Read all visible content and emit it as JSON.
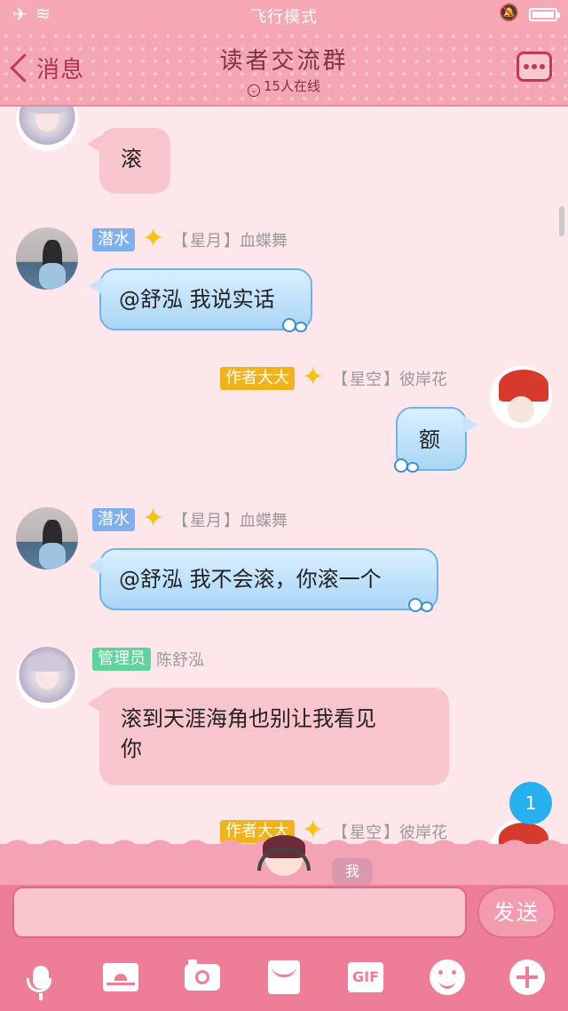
{
  "status_bar": {
    "mode": "飞行模式"
  },
  "header": {
    "back_label": "消息",
    "title": "读者交流群",
    "online": "15人在线"
  },
  "messages": [
    {
      "side": "left",
      "avatar": "girl-silver-icon",
      "text": "滚"
    },
    {
      "side": "left",
      "avatar": "girl-photo-icon",
      "badge": "潜水",
      "title_bracket_l": "【",
      "title": "星月",
      "title_bracket_r": "】",
      "name": "血蝶舞",
      "text": "@舒泓 我说实话"
    },
    {
      "side": "right",
      "avatar": "umbrella-girl-icon",
      "badge": "作者大大",
      "title_bracket_l": "【",
      "title": "星空",
      "title_bracket_r": "】",
      "name": "彼岸花",
      "text": "额"
    },
    {
      "side": "left",
      "avatar": "girl-photo-icon",
      "badge": "潜水",
      "title_bracket_l": "【",
      "title": "星月",
      "title_bracket_r": "】",
      "name": "血蝶舞",
      "text": "@舒泓 我不会滚，你滚一个"
    },
    {
      "side": "left",
      "avatar": "girl-silver-icon",
      "badge": "管理员",
      "name": "陈舒泓",
      "text_line1": "滚到天涯海角也别让我看见",
      "text_line2": "你"
    },
    {
      "side": "right",
      "avatar": "umbrella-girl-icon",
      "badge": "作者大大",
      "title_bracket_l": "【",
      "title": "星空",
      "title_bracket_r": "】",
      "name": "彼岸花"
    }
  ],
  "unread_count": "1",
  "composer": {
    "me_tag": "我",
    "input_value": "",
    "send_label": "发送"
  },
  "toolbar": {
    "gif_label": "GIF",
    "icons": [
      "microphone-icon",
      "image-icon",
      "camera-icon",
      "envelope-icon",
      "gif-icon",
      "emoji-icon",
      "plus-icon"
    ]
  },
  "colors": {
    "header_bg": "#f4a6b4",
    "bubble_pink": "#f8c5cd",
    "bubble_blue": "#a9d6f6",
    "badge_blue": "#7fb0ee",
    "badge_green": "#5fd39a",
    "badge_gold": "#f2b21c",
    "bottom_bg": "#ee7e97"
  }
}
